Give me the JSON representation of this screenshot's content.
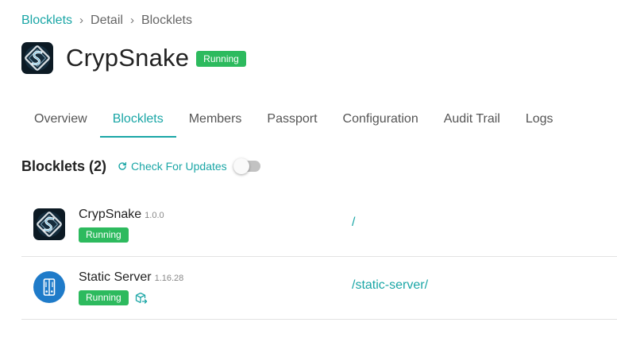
{
  "breadcrumb": {
    "items": [
      "Blocklets",
      "Detail",
      "Blocklets"
    ],
    "separator": "›"
  },
  "app": {
    "title": "CrypSnake",
    "status": "Running",
    "logo_icon": "crypsnake-logo-icon"
  },
  "tabs": [
    {
      "label": "Overview",
      "active": false
    },
    {
      "label": "Blocklets",
      "active": true
    },
    {
      "label": "Members",
      "active": false
    },
    {
      "label": "Passport",
      "active": false
    },
    {
      "label": "Configuration",
      "active": false
    },
    {
      "label": "Audit Trail",
      "active": false
    },
    {
      "label": "Logs",
      "active": false
    }
  ],
  "section": {
    "title": "Blocklets (2)",
    "check_updates_label": "Check For Updates",
    "check_updates_icon": "refresh-icon",
    "auto_update_toggle": false
  },
  "blocklets": [
    {
      "name": "CrypSnake",
      "version": "1.0.0",
      "status": "Running",
      "path": "/",
      "icon": "crypsnake-logo-icon"
    },
    {
      "name": "Static Server",
      "version": "1.16.28",
      "status": "Running",
      "path": "/static-server/",
      "icon": "static-server-icon",
      "action_icon": "open-component-icon"
    }
  ],
  "colors": {
    "accent": "#1aa6a6",
    "running": "#2dba5e",
    "text": "#222222",
    "muted": "#666666",
    "divider": "#e3e3e3"
  }
}
